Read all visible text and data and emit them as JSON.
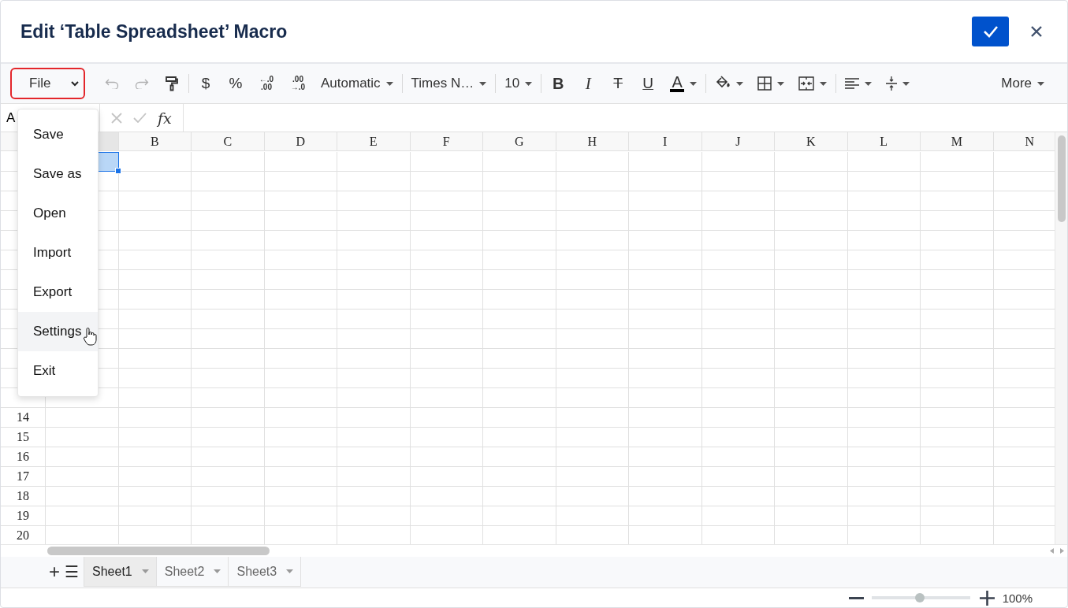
{
  "dialog": {
    "title": "Edit ‘Table Spreadsheet’ Macro"
  },
  "toolbar": [
    {
      "kind": "select",
      "label": "File",
      "focused": true,
      "disabled": false
    },
    {
      "kind": "undo",
      "disabled": true
    },
    {
      "kind": "redo",
      "disabled": true
    },
    {
      "kind": "paint-format",
      "disabled": false
    },
    {
      "kind": "separator"
    },
    {
      "kind": "glyph",
      "text": "$",
      "disabled": false
    },
    {
      "kind": "glyph",
      "text": "%",
      "disabled": false
    },
    {
      "kind": "decimal",
      "lines": [
        "←.0",
        ".00"
      ],
      "disabled": false
    },
    {
      "kind": "decimal",
      "lines": [
        ".00",
        "→.0"
      ],
      "disabled": false
    },
    {
      "kind": "dropdown",
      "label": "Automatic",
      "disabled": false
    },
    {
      "kind": "separator"
    },
    {
      "kind": "dropdown",
      "label": "Times N…",
      "disabled": false
    },
    {
      "kind": "separator"
    },
    {
      "kind": "dropdown",
      "label": "10",
      "disabled": false
    },
    {
      "kind": "separator"
    },
    {
      "kind": "bold",
      "text": "B",
      "disabled": false
    },
    {
      "kind": "italic",
      "text": "I",
      "disabled": false
    },
    {
      "kind": "strike",
      "text": "T",
      "disabled": false
    },
    {
      "kind": "underline",
      "text": "U",
      "disabled": false
    },
    {
      "kind": "font-color",
      "text": "A",
      "color": "#000000",
      "disabled": false
    },
    {
      "kind": "separator"
    },
    {
      "kind": "fill-color",
      "disabled": false
    },
    {
      "kind": "borders",
      "disabled": false
    },
    {
      "kind": "merge",
      "disabled": false
    },
    {
      "kind": "separator"
    },
    {
      "kind": "align",
      "disabled": false
    },
    {
      "kind": "valign",
      "disabled": false
    },
    {
      "kind": "more",
      "label": "More",
      "disabled": false
    }
  ],
  "formula_bar": {
    "name_box": "A",
    "fx": "fx"
  },
  "grid": {
    "columns": [
      "B",
      "C",
      "D",
      "E",
      "F",
      "G",
      "H",
      "I",
      "J",
      "K",
      "L",
      "M",
      "N"
    ],
    "row_labels": [
      "14",
      "15",
      "16",
      "17",
      "18",
      "19",
      "20"
    ],
    "selection_shown": true
  },
  "file_menu": {
    "items": [
      {
        "label": "Save",
        "hovered": false
      },
      {
        "label": "Save as",
        "hovered": false
      },
      {
        "label": "Open",
        "hovered": false
      },
      {
        "label": "Import",
        "hovered": false
      },
      {
        "label": "Export",
        "hovered": false
      },
      {
        "label": "Settings",
        "hovered": true
      },
      {
        "label": "Exit",
        "hovered": false
      }
    ]
  },
  "sheet_bar": {
    "add": "+",
    "list": "☰",
    "tabs": [
      {
        "label": "Sheet1",
        "selected": true
      },
      {
        "label": "Sheet2",
        "selected": false
      },
      {
        "label": "Sheet3",
        "selected": false
      }
    ]
  },
  "status_bar": {
    "zoom": {
      "level": 0.49,
      "reading": "100%"
    }
  }
}
